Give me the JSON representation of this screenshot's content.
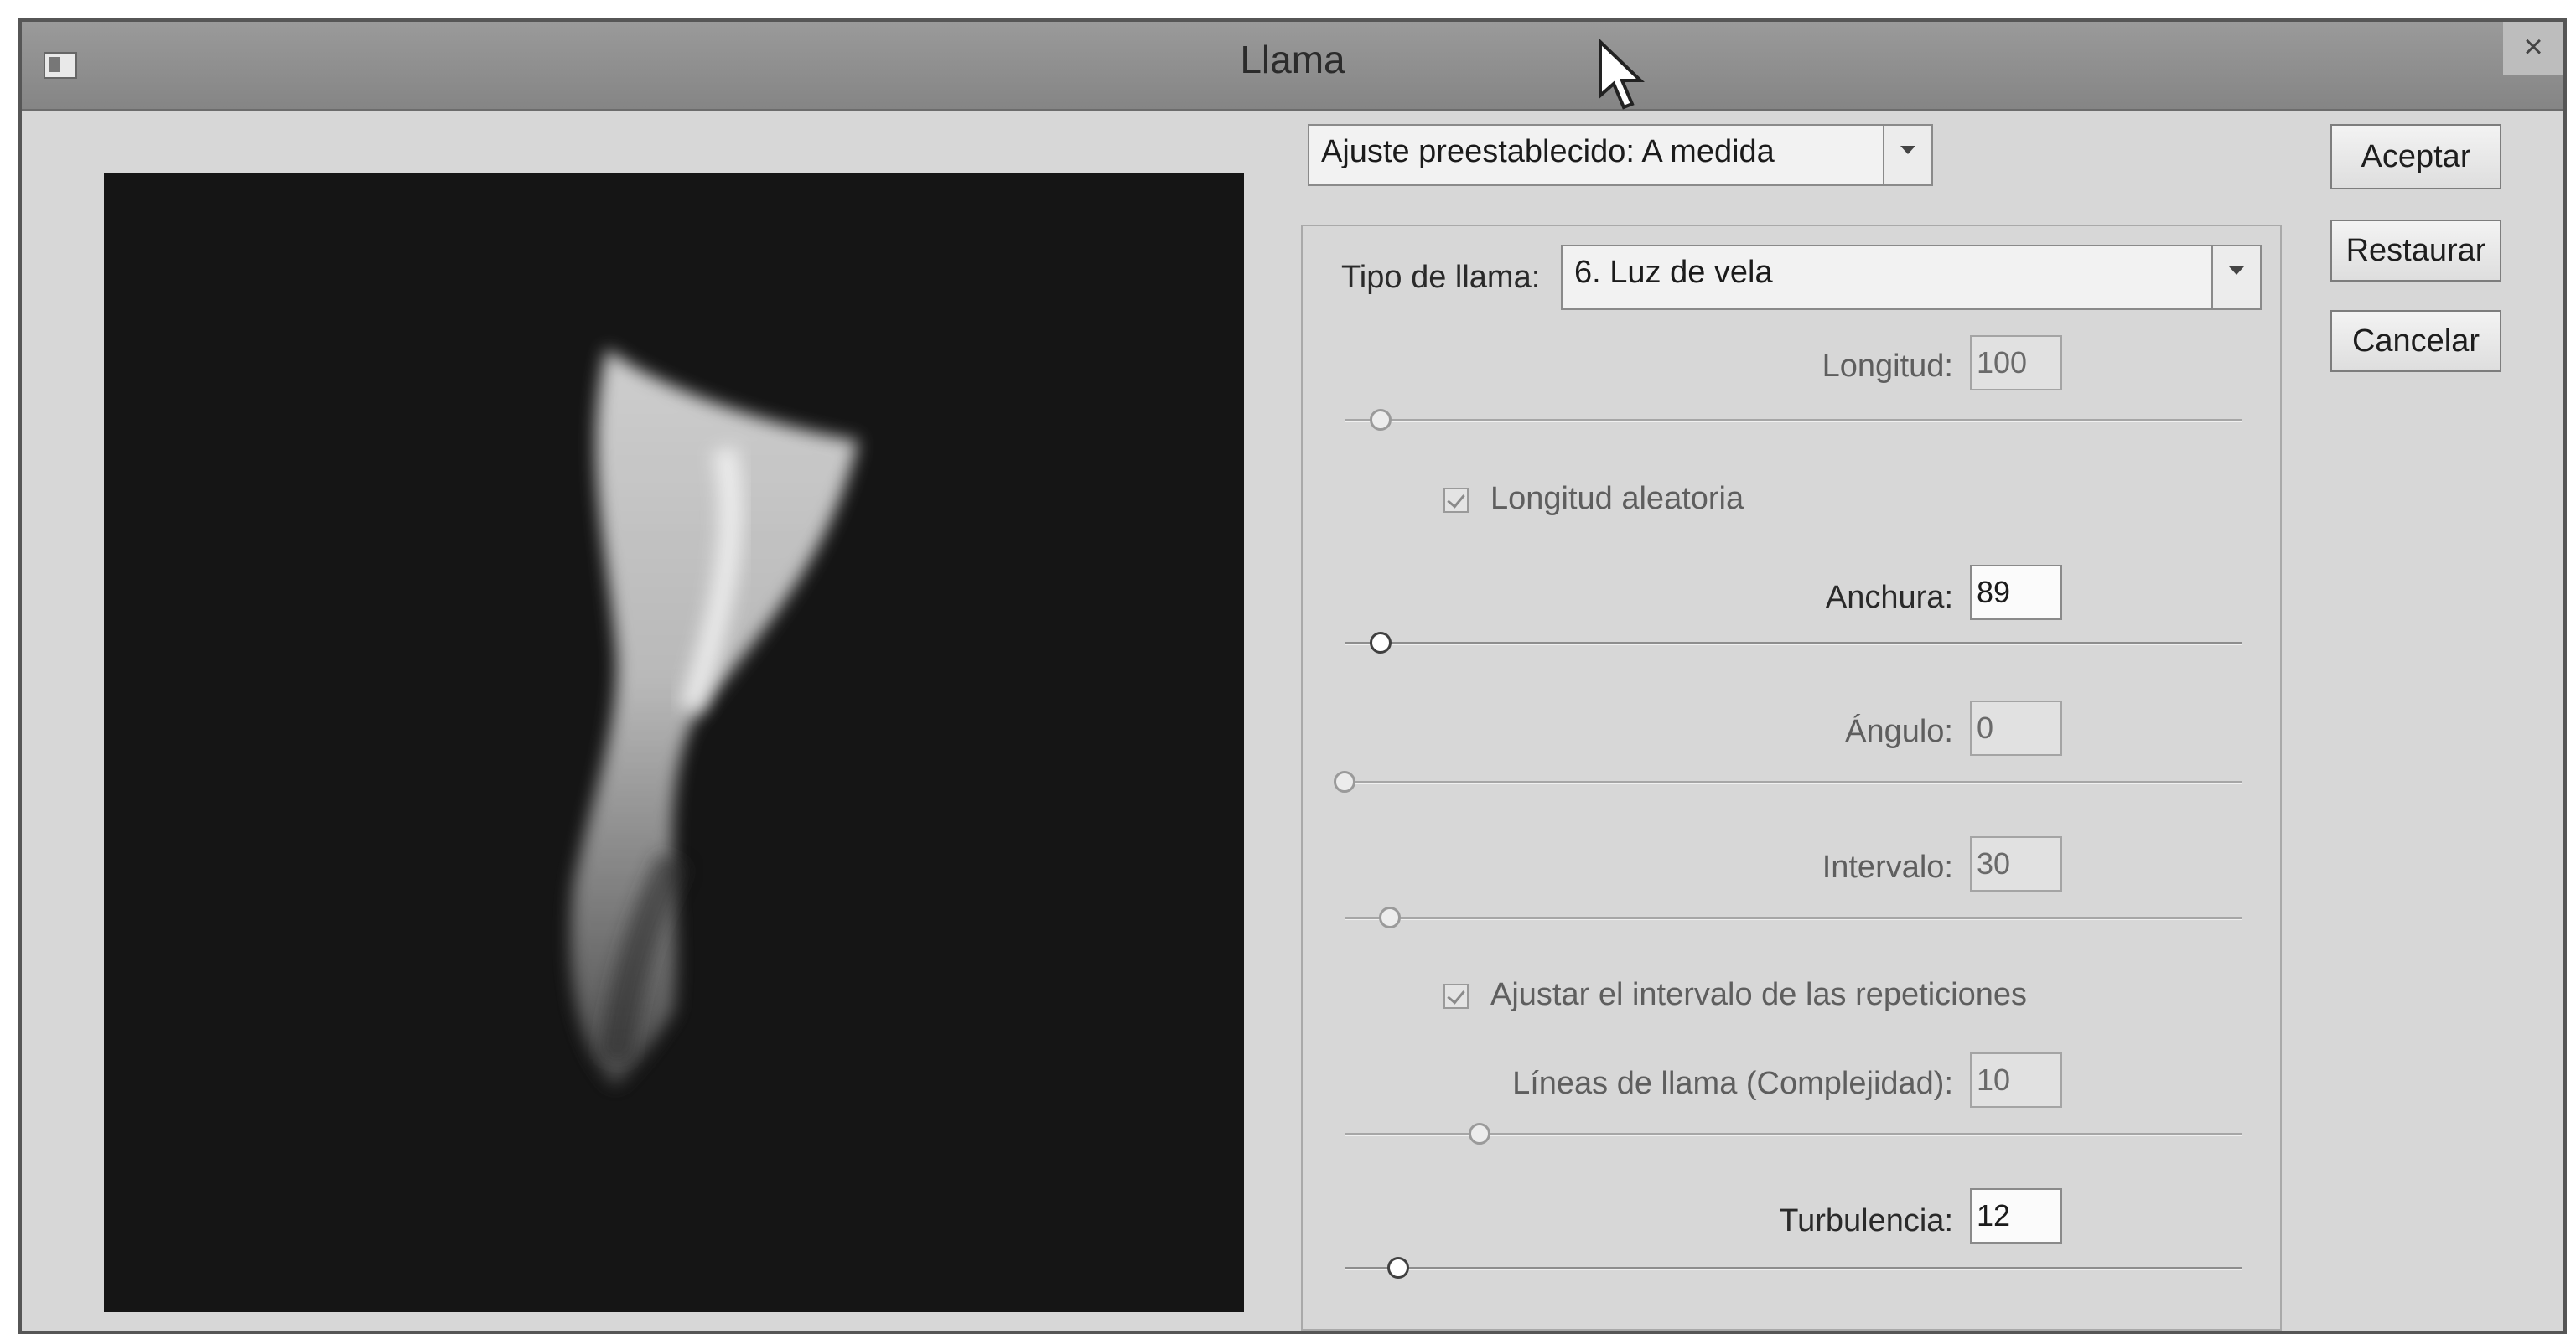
{
  "window": {
    "title": "Llama",
    "close_glyph": "×",
    "icon": "app-window-icon"
  },
  "preset": {
    "label": "Ajuste preestablecido: A medida"
  },
  "buttons": {
    "accept": "Aceptar",
    "restore": "Restaurar",
    "cancel": "Cancelar"
  },
  "flame_type": {
    "label": "Tipo de llama:",
    "value": "6. Luz de vela"
  },
  "params": {
    "length": {
      "label": "Longitud:",
      "value": "100",
      "enabled": false,
      "slider_fraction": 0.04
    },
    "random_length": {
      "label": "Longitud aleatoria",
      "checked": true,
      "enabled": false
    },
    "width": {
      "label": "Anchura:",
      "value": "89",
      "enabled": true,
      "slider_fraction": 0.04
    },
    "angle": {
      "label": "Ángulo:",
      "value": "0",
      "enabled": false,
      "slider_fraction": 0.0
    },
    "interval": {
      "label": "Intervalo:",
      "value": "30",
      "enabled": false,
      "slider_fraction": 0.05
    },
    "adjust_interval": {
      "label": "Ajustar el intervalo de las repeticiones",
      "checked": true,
      "enabled": false
    },
    "flame_lines": {
      "label": "Líneas de llama (Complejidad):",
      "value": "10",
      "enabled": false,
      "slider_fraction": 0.15
    },
    "turbulence": {
      "label": "Turbulencia:",
      "value": "12",
      "enabled": true,
      "slider_fraction": 0.06
    }
  },
  "colors": {
    "dialog_bg": "#d7d7d7",
    "titlebar": "#8f8f8f",
    "preview_bg": "#151515"
  }
}
